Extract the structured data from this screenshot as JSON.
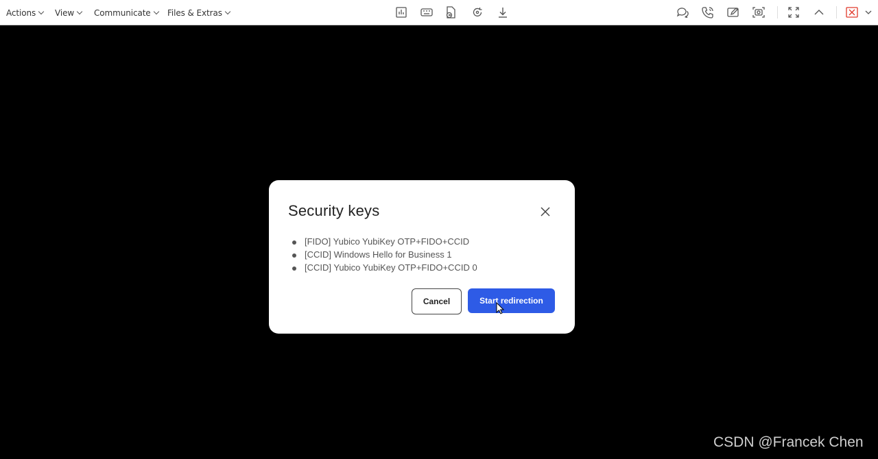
{
  "toolbar": {
    "menus": [
      {
        "label": "Actions"
      },
      {
        "label": "View"
      },
      {
        "label": "Communicate"
      },
      {
        "label": "Files & Extras"
      }
    ],
    "center_icons": [
      "chart-icon",
      "keyboard-icon",
      "file-transfer-icon",
      "refresh-icon",
      "download-icon"
    ],
    "right_icons": [
      "chat-icon",
      "phone-icon",
      "whiteboard-icon",
      "screenshot-icon",
      "fullscreen-icon",
      "collapse-icon",
      "disconnect-icon",
      "more-dropdown-icon"
    ]
  },
  "dialog": {
    "title": "Security keys",
    "keys": [
      "[FIDO] Yubico YubiKey OTP+FIDO+CCID",
      "[CCID] Windows Hello for Business 1",
      "[CCID] Yubico YubiKey OTP+FIDO+CCID 0"
    ],
    "cancel_label": "Cancel",
    "start_label": "Start redirection"
  },
  "watermark": "CSDN @Francek Chen",
  "colors": {
    "accent": "#2e5be6",
    "disconnect": "#e0392a",
    "background": "#000000"
  }
}
